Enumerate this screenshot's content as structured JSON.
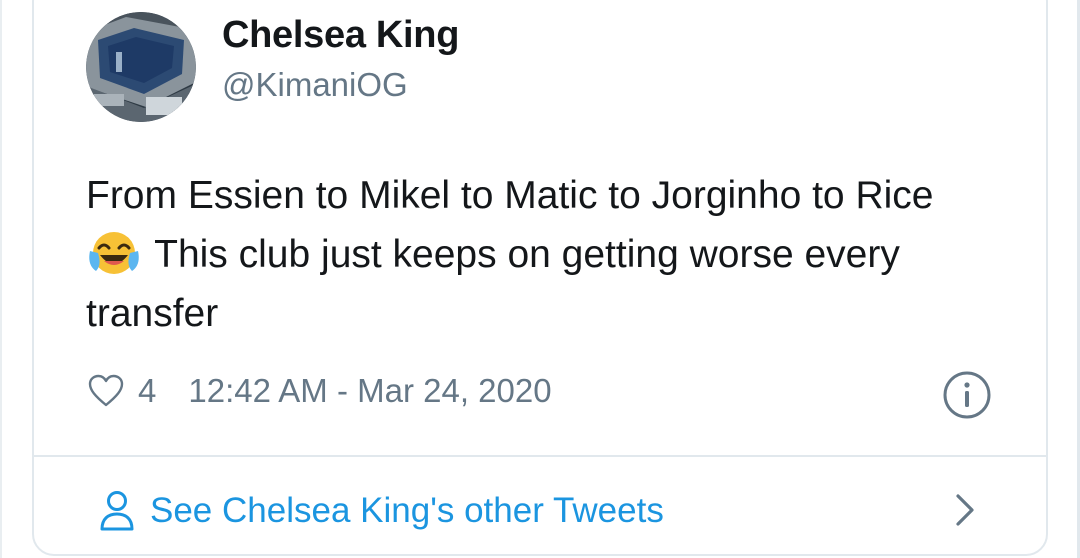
{
  "tweet": {
    "display_name": "Chelsea King",
    "handle": "@KimaniOG",
    "text_before_emoji": "From Essien to Mikel to Matic to Jorginho to Rice",
    "emoji": "face-with-tears-of-joy",
    "text_after_emoji": " This club just keeps on getting worse every transfer",
    "like_count": "4",
    "timestamp": "12:42 AM - Mar 24, 2020"
  },
  "footer": {
    "other_tweets_label": "See Chelsea King's other Tweets"
  },
  "icons": {
    "like": "heart-icon",
    "info": "info-icon",
    "person": "person-icon",
    "chevron": "chevron-right-icon"
  },
  "colors": {
    "text_primary": "#14171a",
    "text_secondary": "#657786",
    "link": "#1b95e0",
    "border": "#e1e8ed"
  }
}
